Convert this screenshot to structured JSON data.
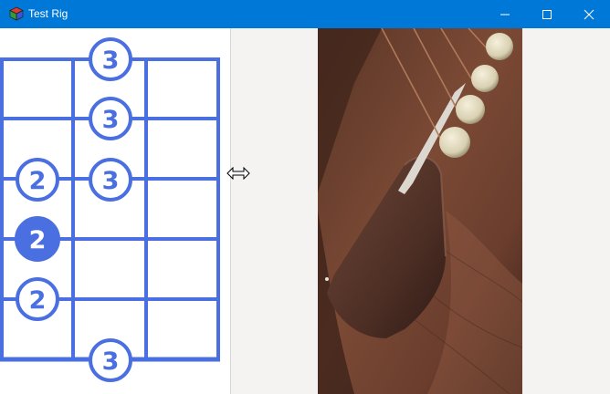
{
  "window": {
    "title": "Test Rig"
  },
  "icons": {
    "app": "app-cube-icon",
    "minimize": "minimize-icon",
    "maximize": "maximize-icon",
    "close": "close-icon",
    "cursor": "horizontal-resize-cursor-icon"
  },
  "colors": {
    "titlebar": "#0078d7",
    "diagram": "#4a6fe0"
  },
  "chord": {
    "markers": [
      {
        "label": "3",
        "filled": false
      },
      {
        "label": "3",
        "filled": false
      },
      {
        "label": "2",
        "filled": false
      },
      {
        "label": "3",
        "filled": false
      },
      {
        "label": "2",
        "filled": true
      },
      {
        "label": "2",
        "filled": false
      },
      {
        "label": "3",
        "filled": false
      }
    ]
  }
}
